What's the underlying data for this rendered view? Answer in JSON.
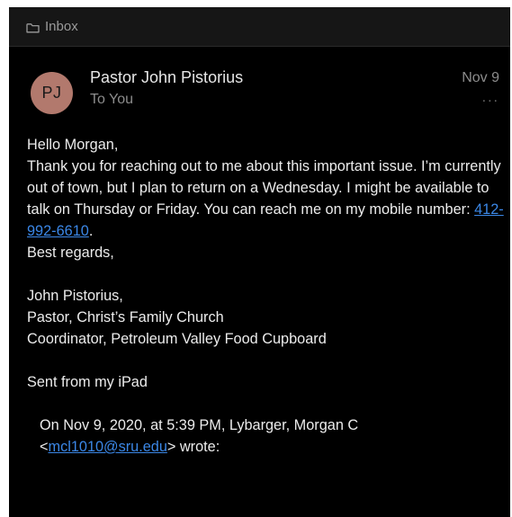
{
  "topbar": {
    "folder_icon": "folder-icon",
    "folder_label": "Inbox"
  },
  "header": {
    "avatar_initials": "PJ",
    "avatar_color": "#b2796d",
    "sender_name": "Pastor John Pistorius",
    "recipient": "To You",
    "date": "Nov 9",
    "more_icon": "more-icon",
    "more_glyph": "..."
  },
  "message": {
    "greeting": "Hello Morgan,",
    "paragraph_before_phone": "Thank you for reaching out to me about this important issue. I’m currently out of town, but I plan to return on a Wednesday. I might be available to talk on Thursday or Friday. You can reach me on my mobile number: ",
    "phone": "412-992-6610",
    "after_phone": ".",
    "closing": "Best regards,",
    "signature": [
      "John Pistorius,",
      "Pastor, Christ’s Family Church",
      "Coordinator, Petroleum Valley Food Cupboard"
    ],
    "sent_from": "Sent from my iPad",
    "quote_line1": "On Nov 9, 2020, at 5:39 PM, Lybarger, Morgan C",
    "quote_email_open": "<",
    "quote_email": "mcl1010@sru.edu",
    "quote_email_close": "> wrote:"
  },
  "colors": {
    "background": "#000000",
    "topbar": "#161616",
    "link": "#3b87e6",
    "text": "#ececec",
    "muted": "#8c8c8c"
  }
}
